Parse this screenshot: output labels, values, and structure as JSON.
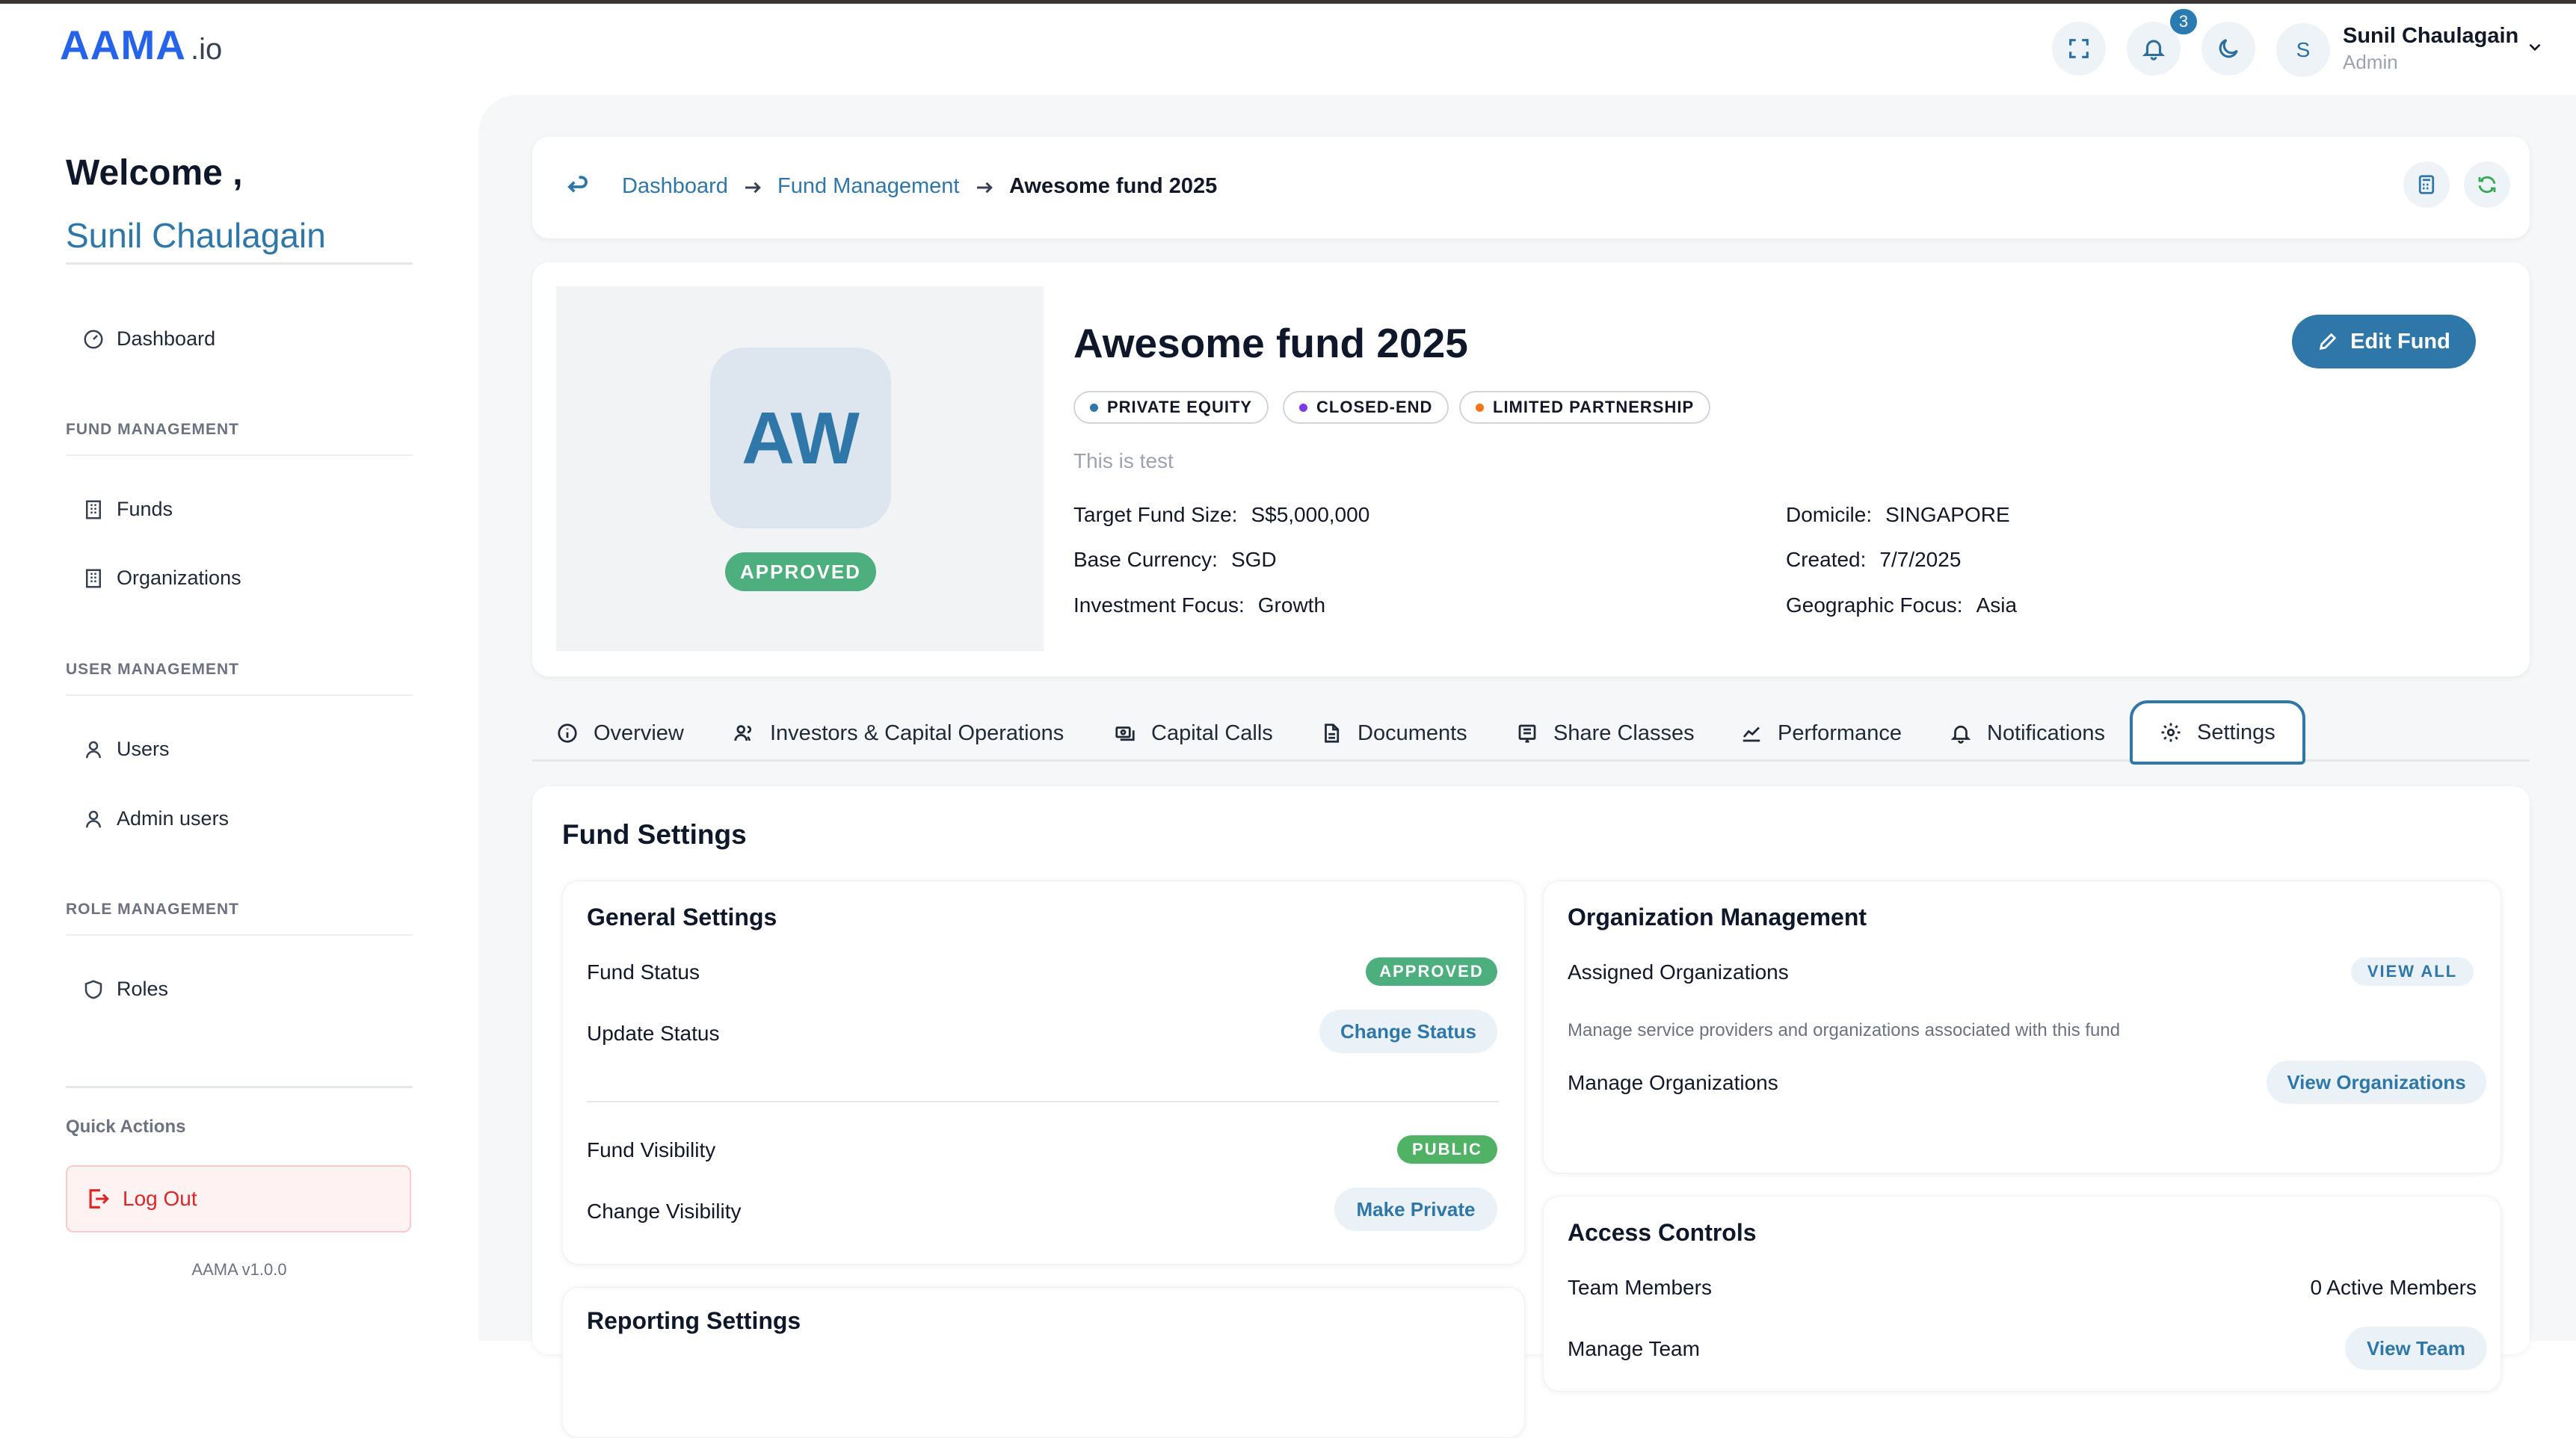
{
  "header": {
    "logo_main": "AAMA",
    "logo_suffix": ".io",
    "notifications_count": "3",
    "user_initial": "S",
    "user_name": "Sunil Chaulagain",
    "user_role": "Admin"
  },
  "sidebar": {
    "welcome": "Welcome ,",
    "welcome_name": "Sunil Chaulagain",
    "dashboard": "Dashboard",
    "sections": {
      "fund_management": "FUND MANAGEMENT",
      "user_management": "USER MANAGEMENT",
      "role_management": "ROLE MANAGEMENT"
    },
    "items": {
      "funds": "Funds",
      "organizations": "Organizations",
      "users": "Users",
      "admin_users": "Admin users",
      "roles": "Roles"
    },
    "quick_actions": "Quick Actions",
    "logout": "Log Out",
    "version": "AAMA v1.0.0"
  },
  "breadcrumb": {
    "items": [
      "Dashboard",
      "Fund Management",
      "Awesome fund 2025"
    ]
  },
  "fund": {
    "initials": "AW",
    "status": "APPROVED",
    "title": "Awesome fund 2025",
    "tags": [
      {
        "label": "PRIVATE EQUITY",
        "color": "#2f77a8"
      },
      {
        "label": "CLOSED-END",
        "color": "#7c3aed"
      },
      {
        "label": "LIMITED PARTNERSHIP",
        "color": "#f97316"
      }
    ],
    "description": "This is test",
    "details": {
      "target_size_label": "Target Fund Size:",
      "target_size": "S$5,000,000",
      "base_currency_label": "Base Currency:",
      "base_currency": "SGD",
      "investment_focus_label": "Investment Focus:",
      "investment_focus": "Growth",
      "domicile_label": "Domicile:",
      "domicile": "SINGAPORE",
      "created_label": "Created:",
      "created": "7/7/2025",
      "geo_focus_label": "Geographic Focus:",
      "geo_focus": "Asia"
    },
    "edit_label": "Edit Fund"
  },
  "tabs": [
    "Overview",
    "Investors & Capital Operations",
    "Capital Calls",
    "Documents",
    "Share Classes",
    "Performance",
    "Notifications",
    "Settings"
  ],
  "settings": {
    "title": "Fund Settings",
    "general": {
      "title": "General Settings",
      "fund_status_label": "Fund Status",
      "fund_status_value": "APPROVED",
      "update_status_label": "Update Status",
      "change_status_btn": "Change Status",
      "visibility_label": "Fund Visibility",
      "visibility_value": "PUBLIC",
      "change_visibility_label": "Change Visibility",
      "make_private_btn": "Make Private"
    },
    "reporting_title": "Reporting Settings",
    "org": {
      "title": "Organization Management",
      "assigned_label": "Assigned Organizations",
      "view_all": "VIEW ALL",
      "note": "Manage service providers and organizations associated with this fund",
      "manage_label": "Manage Organizations",
      "view_orgs_btn": "View Organizations"
    },
    "access": {
      "title": "Access Controls",
      "team_label": "Team Members",
      "team_value": "0 Active Members",
      "manage_label": "Manage Team",
      "view_team_btn": "View Team"
    }
  },
  "colors": {
    "brand": "#2563eb",
    "accent": "#2f77a8",
    "success": "#4caf7d",
    "danger": "#dc2626"
  }
}
